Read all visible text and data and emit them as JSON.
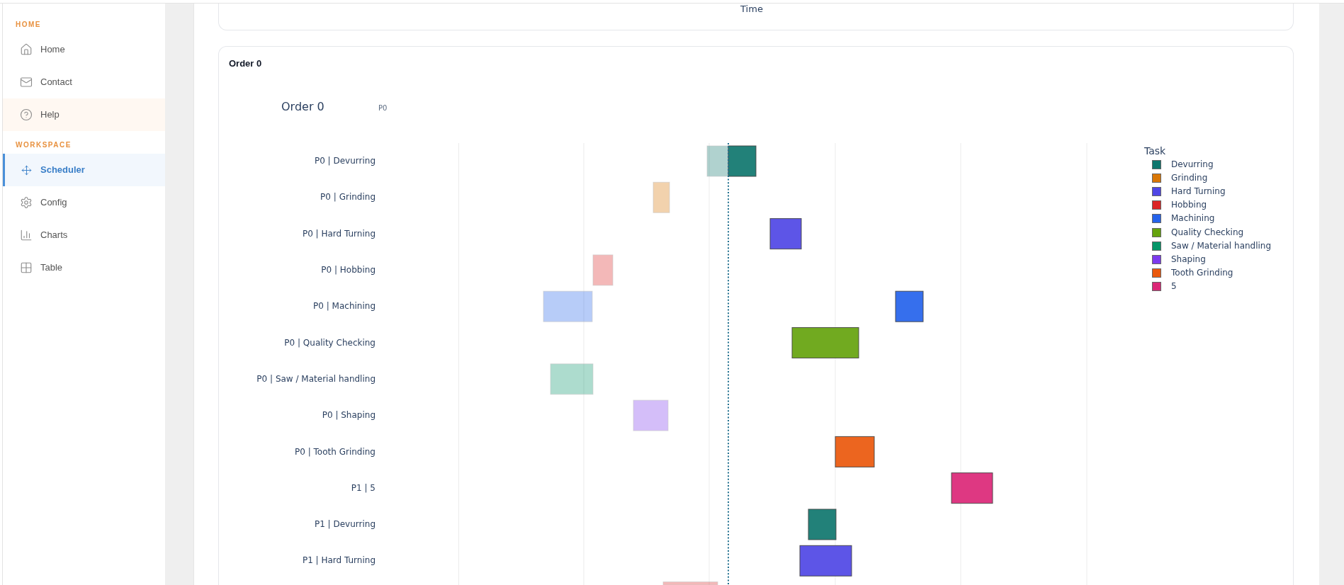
{
  "sidebar": {
    "sections": [
      {
        "heading": "HOME",
        "items": [
          {
            "label": "Home",
            "selected": false,
            "hovered": false
          },
          {
            "label": "Contact",
            "selected": false,
            "hovered": false
          },
          {
            "label": "Help",
            "selected": false,
            "hovered": true
          }
        ]
      },
      {
        "heading": "WORKSPACE",
        "items": [
          {
            "label": "Scheduler",
            "selected": true,
            "hovered": false
          },
          {
            "label": "Config",
            "selected": false,
            "hovered": false
          },
          {
            "label": "Charts",
            "selected": false,
            "hovered": false
          },
          {
            "label": "Table",
            "selected": false,
            "hovered": false
          }
        ]
      }
    ]
  },
  "previous_chart": {
    "axis_title": "Time"
  },
  "order_card": {
    "heading": "Order 0",
    "chart": {
      "title": "Order 0",
      "subtitle": "P0",
      "rows": [
        "P0 | Devurring",
        "P0 | Grinding",
        "P0 | Hard Turning",
        "P0 | Hobbing",
        "P0 | Machining",
        "P0 | Quality Checking",
        "P0 | Saw / Material handling",
        "P0 | Shaping",
        "P0 | Tooth Grinding",
        "P1 | 5",
        "P1 | Devurring",
        "P1 | Hard Turning"
      ],
      "legend": {
        "title": "Task",
        "items": [
          {
            "label": "Devurring",
            "color": "#0f766e"
          },
          {
            "label": "Grinding",
            "color": "#d97706"
          },
          {
            "label": "Hard Turning",
            "color": "#4f46e5"
          },
          {
            "label": "Hobbing",
            "color": "#dc2626"
          },
          {
            "label": "Machining",
            "color": "#2563eb"
          },
          {
            "label": "Quality Checking",
            "color": "#65a30d"
          },
          {
            "label": "Saw / Material handling",
            "color": "#059669"
          },
          {
            "label": "Shaping",
            "color": "#7c3aed"
          },
          {
            "label": "Tooth Grinding",
            "color": "#ea580c"
          },
          {
            "label": "5",
            "color": "#db2777"
          }
        ]
      }
    }
  }
}
